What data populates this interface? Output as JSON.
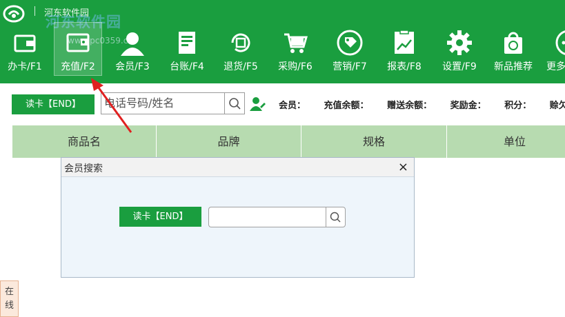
{
  "watermark": {
    "site_name": "河东软件园",
    "site_big": "河东软件园",
    "url": "www.pc0359.cn"
  },
  "toolbar": {
    "items": [
      {
        "label": "办卡/F1",
        "icon": "card-icon"
      },
      {
        "label": "充值/F2",
        "icon": "wallet-icon",
        "active": true
      },
      {
        "label": "会员/F3",
        "icon": "member-icon"
      },
      {
        "label": "台账/F4",
        "icon": "ledger-icon"
      },
      {
        "label": "退货/F5",
        "icon": "return-icon"
      },
      {
        "label": "采购/F6",
        "icon": "cart-icon"
      },
      {
        "label": "营销/F7",
        "icon": "tag-icon"
      },
      {
        "label": "报表/F8",
        "icon": "report-icon"
      },
      {
        "label": "设置/F9",
        "icon": "gear-icon"
      },
      {
        "label": "新品推荐",
        "icon": "shopping-bag-icon"
      },
      {
        "label": "更多",
        "icon": "more-icon"
      }
    ]
  },
  "search": {
    "read_card_label": "读卡【END】",
    "placeholder": "电话号码/姓名"
  },
  "member_info": {
    "labels": [
      "会员：",
      "充值余额：",
      "赠送余额：",
      "奖励金：",
      "积分：",
      "赊欠："
    ]
  },
  "table": {
    "columns": [
      "商品名",
      "品牌",
      "规格",
      "单位"
    ]
  },
  "dialog": {
    "title": "会员搜索",
    "close": "×",
    "read_card_label": "读卡【END】",
    "input_value": ""
  },
  "online_service": {
    "label": "在线"
  },
  "colors": {
    "brand_green": "#1a9e3f",
    "table_header": "#b7dbb0",
    "annotation_arrow": "#e02020"
  }
}
